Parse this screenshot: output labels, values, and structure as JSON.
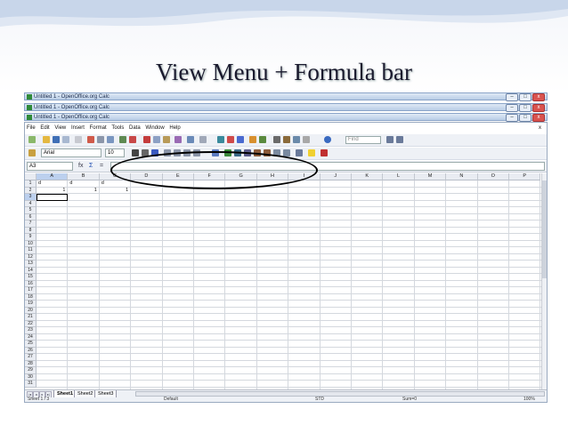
{
  "slide": {
    "title": "View Menu + Formula bar"
  },
  "windows": [
    {
      "title": "Untitled 1 - OpenOffice.org Calc"
    },
    {
      "title": "Untitled 1 - OpenOffice.org Calc"
    },
    {
      "title": "Untitled 1 - OpenOffice.org Calc"
    }
  ],
  "window_controls": {
    "minimize": "–",
    "maximize": "□",
    "close": "x"
  },
  "menubar": {
    "items": [
      "File",
      "Edit",
      "View",
      "Insert",
      "Format",
      "Tools",
      "Data",
      "Window",
      "Help"
    ],
    "close": "x"
  },
  "toolbar": {
    "font_name": "Arial",
    "font_size": "10",
    "find_placeholder": "Find"
  },
  "formula_bar": {
    "name_box": "A3",
    "func_wizard": "fx",
    "sum": "Σ",
    "equals": "="
  },
  "sheet": {
    "columns": [
      "A",
      "B",
      "C",
      "D",
      "E",
      "F",
      "G",
      "H",
      "I",
      "J",
      "K",
      "L",
      "M",
      "N",
      "O",
      "P"
    ],
    "rows": [
      "1",
      "2",
      "3",
      "4",
      "5",
      "6",
      "7",
      "8",
      "9",
      "10",
      "11",
      "12",
      "13",
      "14",
      "15",
      "16",
      "17",
      "18",
      "19",
      "20",
      "21",
      "22",
      "23",
      "24",
      "25",
      "26",
      "27",
      "28",
      "29",
      "30",
      "31"
    ],
    "selected_cell": "A3",
    "cells": {
      "A1": "d",
      "B1": "d",
      "C1": "d",
      "A2": "1",
      "B2": "1",
      "C2": "1"
    }
  },
  "sheet_tabs": [
    "Sheet1",
    "Sheet2",
    "Sheet3"
  ],
  "status": {
    "sheet": "Sheet 1 / 3",
    "style": "Default",
    "mode": "STD",
    "sum": "Sum=0",
    "zoom": "100%"
  },
  "colors": {
    "title_text": "#1a1a2e",
    "selection": "#bcd0ee",
    "annotation": "#000000"
  }
}
